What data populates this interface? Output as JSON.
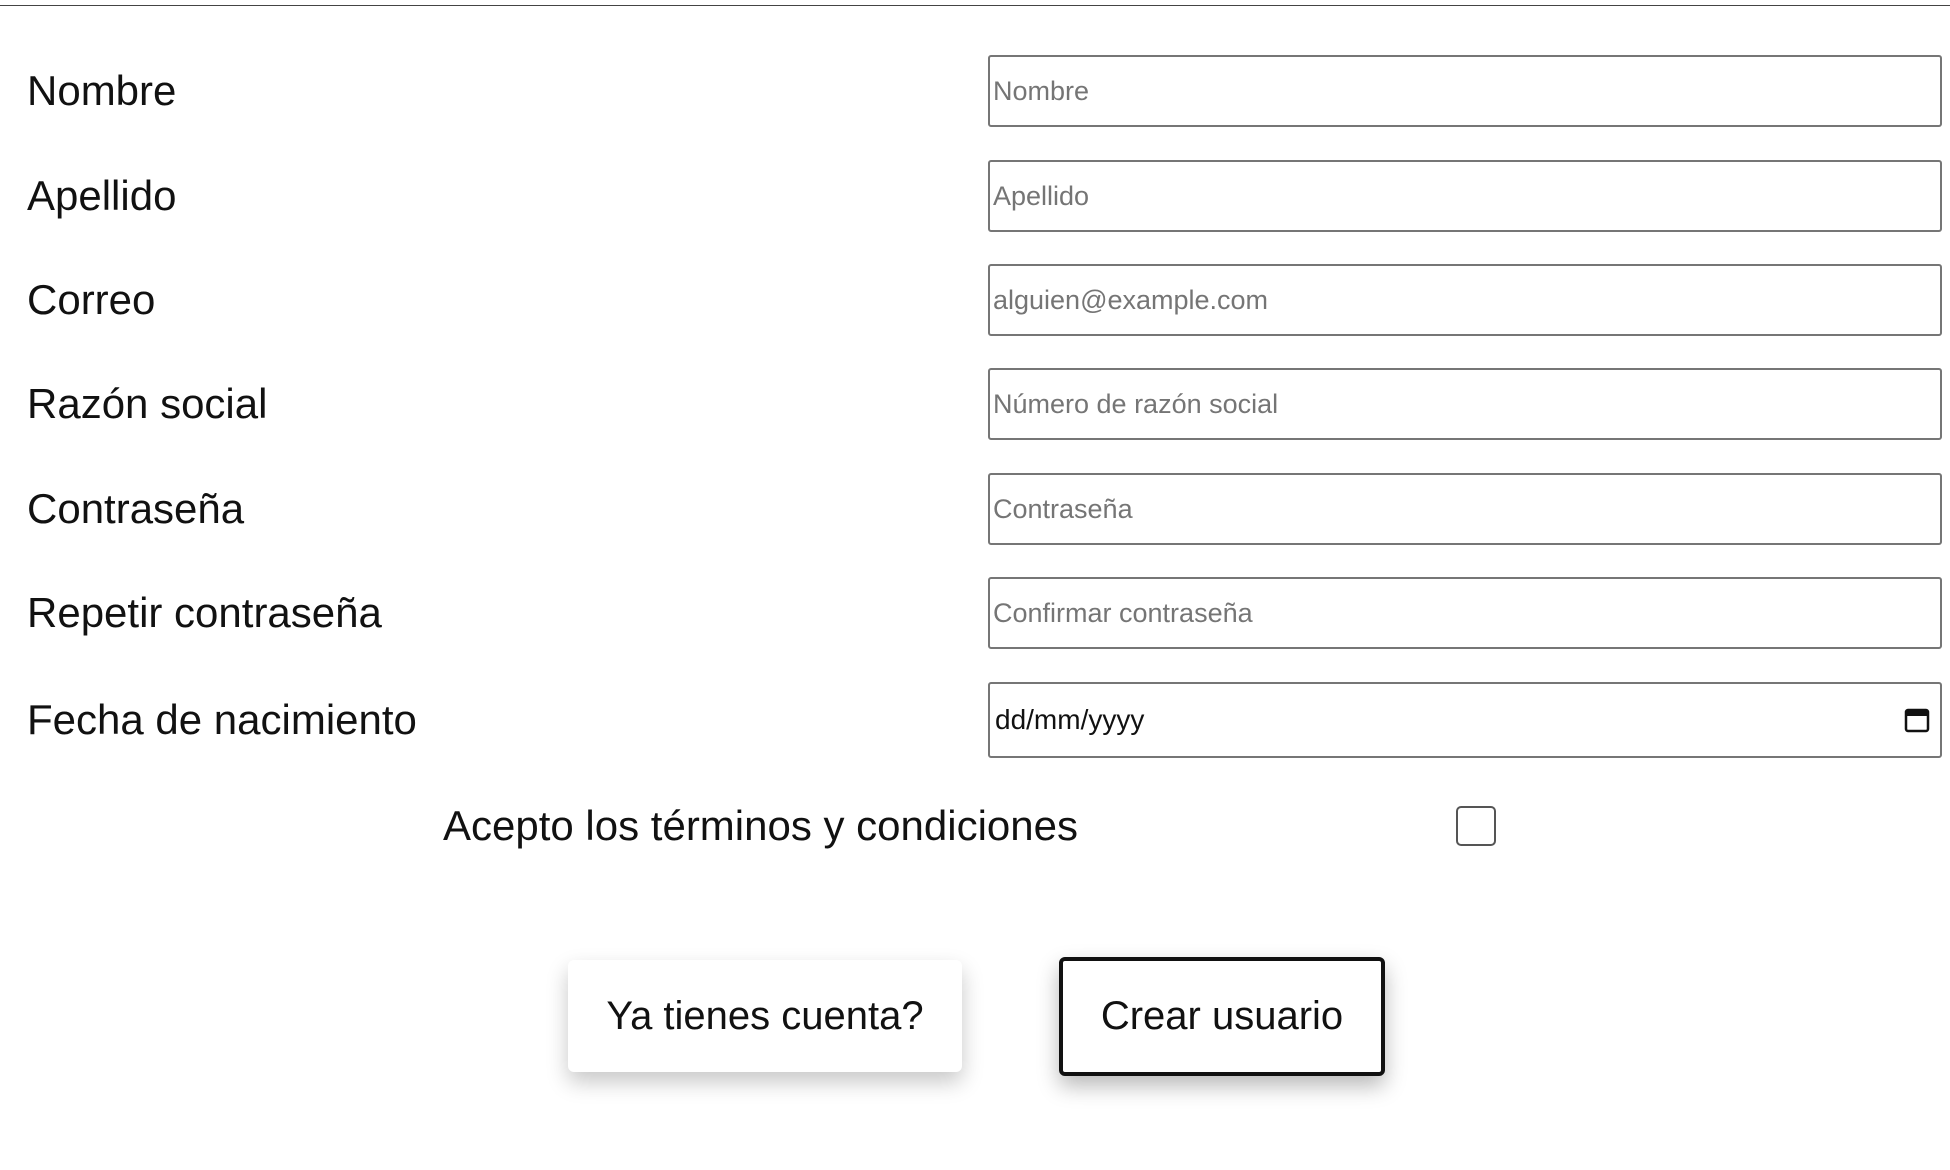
{
  "form": {
    "fields": [
      {
        "label": "Nombre",
        "placeholder": "Nombre",
        "type": "text"
      },
      {
        "label": "Apellido",
        "placeholder": "Apellido",
        "type": "text"
      },
      {
        "label": "Correo",
        "placeholder": "alguien@example.com",
        "type": "email"
      },
      {
        "label": "Razón social",
        "placeholder": "Número de razón social",
        "type": "text"
      },
      {
        "label": "Contraseña",
        "placeholder": "Contraseña",
        "type": "password"
      },
      {
        "label": "Repetir contraseña",
        "placeholder": "Confirmar contraseña",
        "type": "password"
      }
    ],
    "birthdate": {
      "label": "Fecha de nacimiento",
      "value_display": "dd/mm/yyyy",
      "icon": "calendar-icon"
    },
    "terms": {
      "label": "Acepto los términos y condiciones",
      "checked": false
    }
  },
  "actions": {
    "login_label": "Ya tienes cuenta?",
    "create_label": "Crear usuario"
  }
}
